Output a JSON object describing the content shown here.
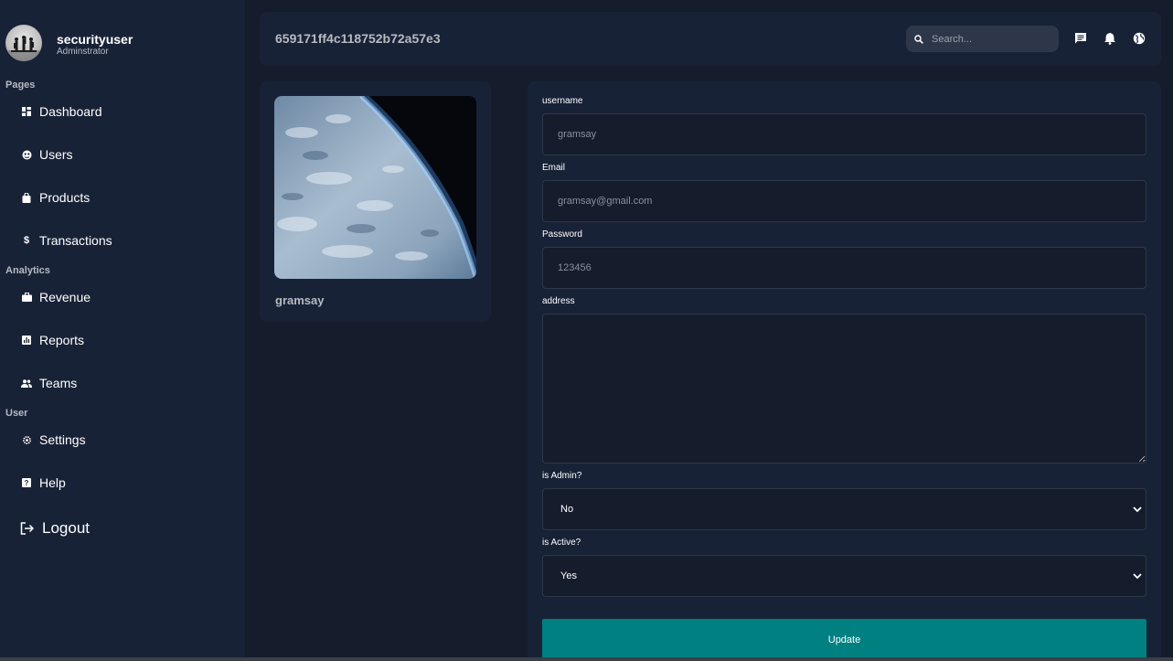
{
  "user": {
    "name": "securityuser",
    "role": "Adminstrator",
    "avatar_icon": "soldiers-silhouette-avatar"
  },
  "sidebar": {
    "sections": [
      {
        "title": "Pages",
        "items": [
          {
            "label": "Dashboard",
            "icon": "dashboard-icon"
          },
          {
            "label": "Users",
            "icon": "users-icon"
          },
          {
            "label": "Products",
            "icon": "shopping-bag-icon"
          },
          {
            "label": "Transactions",
            "icon": "dollar-icon"
          }
        ]
      },
      {
        "title": "Analytics",
        "items": [
          {
            "label": "Revenue",
            "icon": "briefcase-icon"
          },
          {
            "label": "Reports",
            "icon": "chart-icon"
          },
          {
            "label": "Teams",
            "icon": "people-icon"
          }
        ]
      },
      {
        "title": "User",
        "items": [
          {
            "label": "Settings",
            "icon": "gear-icon"
          },
          {
            "label": "Help",
            "icon": "help-icon"
          }
        ]
      }
    ],
    "logout_label": "Logout"
  },
  "topbar": {
    "title": "659171ff4c118752b72a57e3",
    "search_placeholder": "Search...",
    "icons": [
      "chat-icon",
      "bell-icon",
      "globe-icon"
    ]
  },
  "profile": {
    "name": "gramsay",
    "image": "earth-from-space-image"
  },
  "form": {
    "username_label": "username",
    "username_placeholder": "gramsay",
    "email_label": "Email",
    "email_placeholder": "gramsay@gmail.com",
    "password_label": "Password",
    "password_placeholder": "123456",
    "address_label": "address",
    "address_value": "",
    "is_admin_label": "is Admin?",
    "is_admin_value": "No",
    "is_active_label": "is Active?",
    "is_active_value": "Yes",
    "update_label": "Update"
  },
  "colors": {
    "background": "#151c2c",
    "panel": "#182237",
    "input_border": "#2e374a",
    "muted_text": "#b7bac1",
    "button": "#008080"
  }
}
